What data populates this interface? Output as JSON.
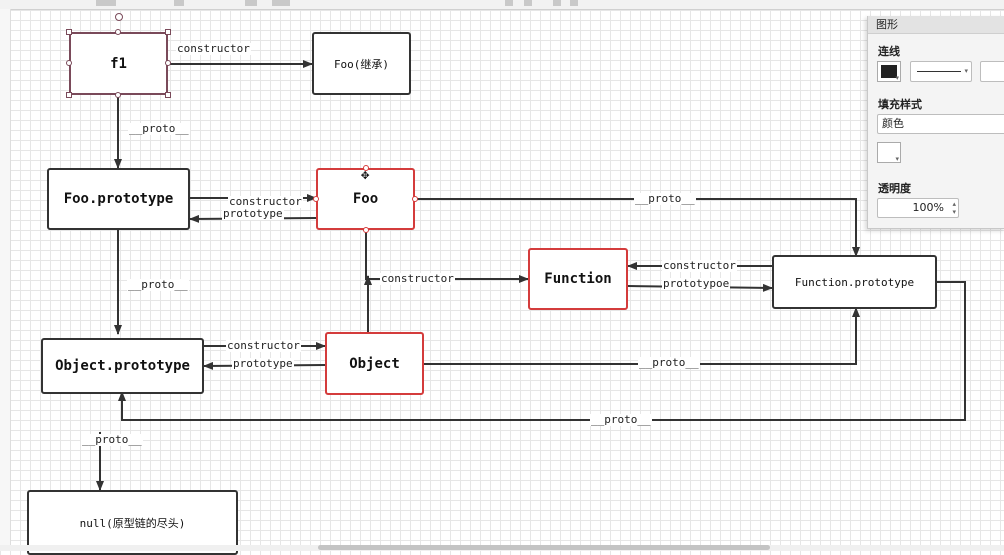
{
  "nodes": {
    "f1": "f1",
    "foo_inherit": "Foo(继承)",
    "foo_prototype": "Foo.prototype",
    "foo": "Foo",
    "function": "Function",
    "function_prototype": "Function.prototype",
    "object_prototype": "Object.prototype",
    "object": "Object",
    "null_end": "null(原型链的尽头)"
  },
  "edge_labels": {
    "f1_constructor": "constructor",
    "f1_proto": "__proto__",
    "fooproto_constructor": "constructor",
    "fooproto_prototype": "prototype",
    "foo_proto": "__proto__",
    "fooproto_proto": "__proto__",
    "foo_constructor": "constructor",
    "function_constructor": "constructor",
    "function_prototypoe": "prototypoe",
    "object_constructor": "constructor",
    "object_prototype": "prototype",
    "object_proto": "__proto__",
    "funcproto_proto": "__proto__",
    "objproto_proto": "__proto__"
  },
  "panel": {
    "title": "图形",
    "line_section": "连线",
    "fill_section": "填充样式",
    "fill_type": "颜色",
    "opacity_section": "透明度",
    "opacity_value": "100%"
  },
  "colors": {
    "node_border": "#333333",
    "highlight_border": "#d43c3c",
    "grid": "#e6e6e6"
  }
}
